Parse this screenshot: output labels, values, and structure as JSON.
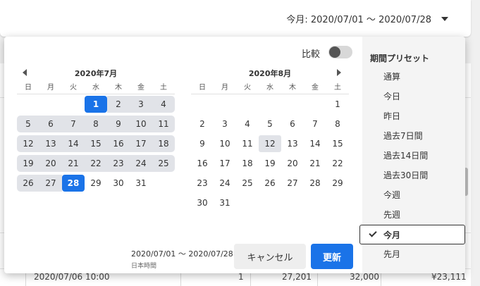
{
  "header": {
    "range_label": "今月: 2020/07/01 〜 2020/07/28"
  },
  "background": {
    "row_date": "2020/07/06 10:00",
    "row_val1": "1",
    "row_val2": "27,201",
    "row_val3": "32,000",
    "row_val4": "¥23,111"
  },
  "compare": {
    "label": "比較",
    "enabled": false
  },
  "calendar": {
    "weekdays": [
      "日",
      "月",
      "火",
      "水",
      "木",
      "金",
      "土"
    ],
    "left": {
      "title": "2020年7月",
      "weeks": [
        [
          "",
          "",
          "",
          "1",
          "2",
          "3",
          "4"
        ],
        [
          "5",
          "6",
          "7",
          "8",
          "9",
          "10",
          "11"
        ],
        [
          "12",
          "13",
          "14",
          "15",
          "16",
          "17",
          "18"
        ],
        [
          "19",
          "20",
          "21",
          "22",
          "23",
          "24",
          "25"
        ],
        [
          "26",
          "27",
          "28",
          "29",
          "30",
          "31",
          ""
        ]
      ]
    },
    "right": {
      "title": "2020年8月",
      "weeks": [
        [
          "",
          "",
          "",
          "",
          "",
          "",
          "1"
        ],
        [
          "2",
          "3",
          "4",
          "5",
          "6",
          "7",
          "8"
        ],
        [
          "9",
          "10",
          "11",
          "12",
          "13",
          "14",
          "15"
        ],
        [
          "16",
          "17",
          "18",
          "19",
          "20",
          "21",
          "22"
        ],
        [
          "23",
          "24",
          "25",
          "26",
          "27",
          "28",
          "29"
        ],
        [
          "30",
          "31",
          "",
          "",
          "",
          "",
          ""
        ]
      ]
    },
    "range_start": "1",
    "range_end": "28",
    "highlight_right": "12"
  },
  "summary": {
    "range": "2020/07/01 〜 2020/07/28",
    "timezone": "日本時間"
  },
  "buttons": {
    "cancel": "キャンセル",
    "update": "更新"
  },
  "presets": {
    "title": "期間プリセット",
    "items": [
      "通算",
      "今日",
      "昨日",
      "過去7日間",
      "過去14日間",
      "過去30日間",
      "今週",
      "先週",
      "今月",
      "先月"
    ],
    "active": "今月"
  },
  "colors": {
    "accent": "#1a73e8",
    "range_fill": "#e1e3e8"
  }
}
